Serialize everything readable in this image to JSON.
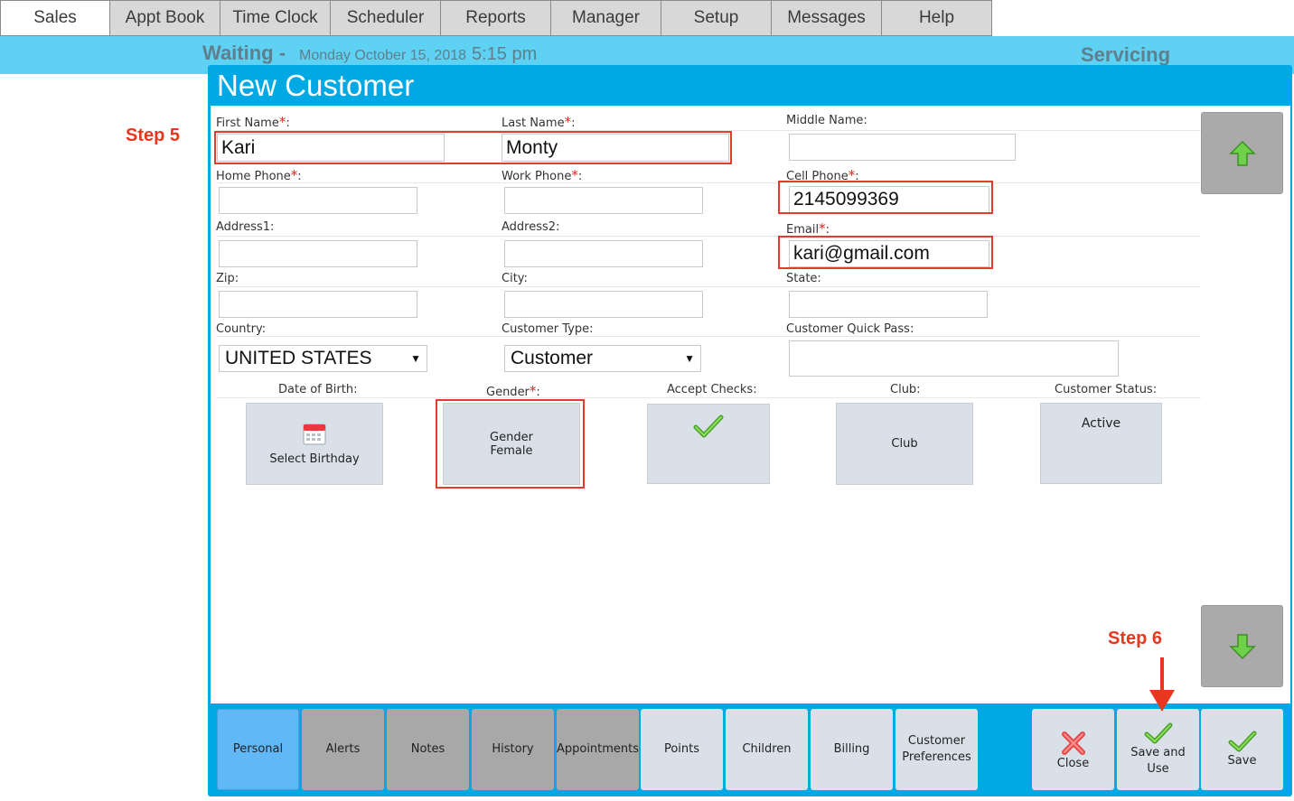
{
  "nav": {
    "tabs": [
      "Sales",
      "Appt Book",
      "Time Clock",
      "Scheduler",
      "Reports",
      "Manager",
      "Setup",
      "Messages",
      "Help"
    ]
  },
  "status": {
    "waiting": "Waiting -",
    "date": "Monday October 15, 2018",
    "time": "5:15 pm",
    "servicing": "Servicing"
  },
  "dialog": {
    "title": "New Customer"
  },
  "annotations": {
    "step5": "Step 5",
    "step6": "Step 6"
  },
  "form": {
    "first_name": {
      "label": "First Name",
      "value": "Kari"
    },
    "last_name": {
      "label": "Last Name",
      "value": "Monty"
    },
    "middle_name": {
      "label": "Middle Name:",
      "value": ""
    },
    "home_phone": {
      "label": "Home Phone",
      "value": ""
    },
    "work_phone": {
      "label": "Work Phone",
      "value": ""
    },
    "cell_phone": {
      "label": "Cell Phone",
      "value": "2145099369"
    },
    "address1": {
      "label": "Address1:",
      "value": ""
    },
    "address2": {
      "label": "Address2:",
      "value": ""
    },
    "email": {
      "label": "Email",
      "value": "kari@gmail.com"
    },
    "zip": {
      "label": "Zip:",
      "value": ""
    },
    "city": {
      "label": "City:",
      "value": ""
    },
    "state": {
      "label": "State:",
      "value": ""
    },
    "country": {
      "label": "Country:",
      "value": "UNITED STATES"
    },
    "customer_type": {
      "label": "Customer Type:",
      "value": "Customer"
    },
    "quick_pass": {
      "label": "Customer Quick Pass:",
      "value": ""
    },
    "dob": {
      "label": "Date of Birth:",
      "button": "Select Birthday"
    },
    "gender": {
      "label": "Gender",
      "line1": "Gender",
      "line2": "Female"
    },
    "accept_checks": {
      "label": "Accept Checks:"
    },
    "club": {
      "label": "Club:",
      "button": "Club"
    },
    "status": {
      "label": "Customer Status:",
      "value": "Active"
    }
  },
  "bottom_tabs": {
    "personal": "Personal",
    "alerts": "Alerts",
    "notes": "Notes",
    "history": "History",
    "appointments": "Appointments",
    "points": "Points",
    "children": "Children",
    "billing": "Billing",
    "prefs_line1": "Customer",
    "prefs_line2": "Preferences"
  },
  "actions": {
    "close": "Close",
    "save_use_line1": "Save and",
    "save_use_line2": "Use",
    "save": "Save"
  },
  "colors": {
    "accent": "#00a8e4",
    "waiting_bar": "#5fd1f2",
    "highlight": "#e53a2e",
    "active_tab": "#60b8f6"
  },
  "icons": [
    "up-arrow-icon",
    "down-arrow-icon",
    "calendar-icon",
    "checkmark-icon",
    "close-x-icon"
  ]
}
